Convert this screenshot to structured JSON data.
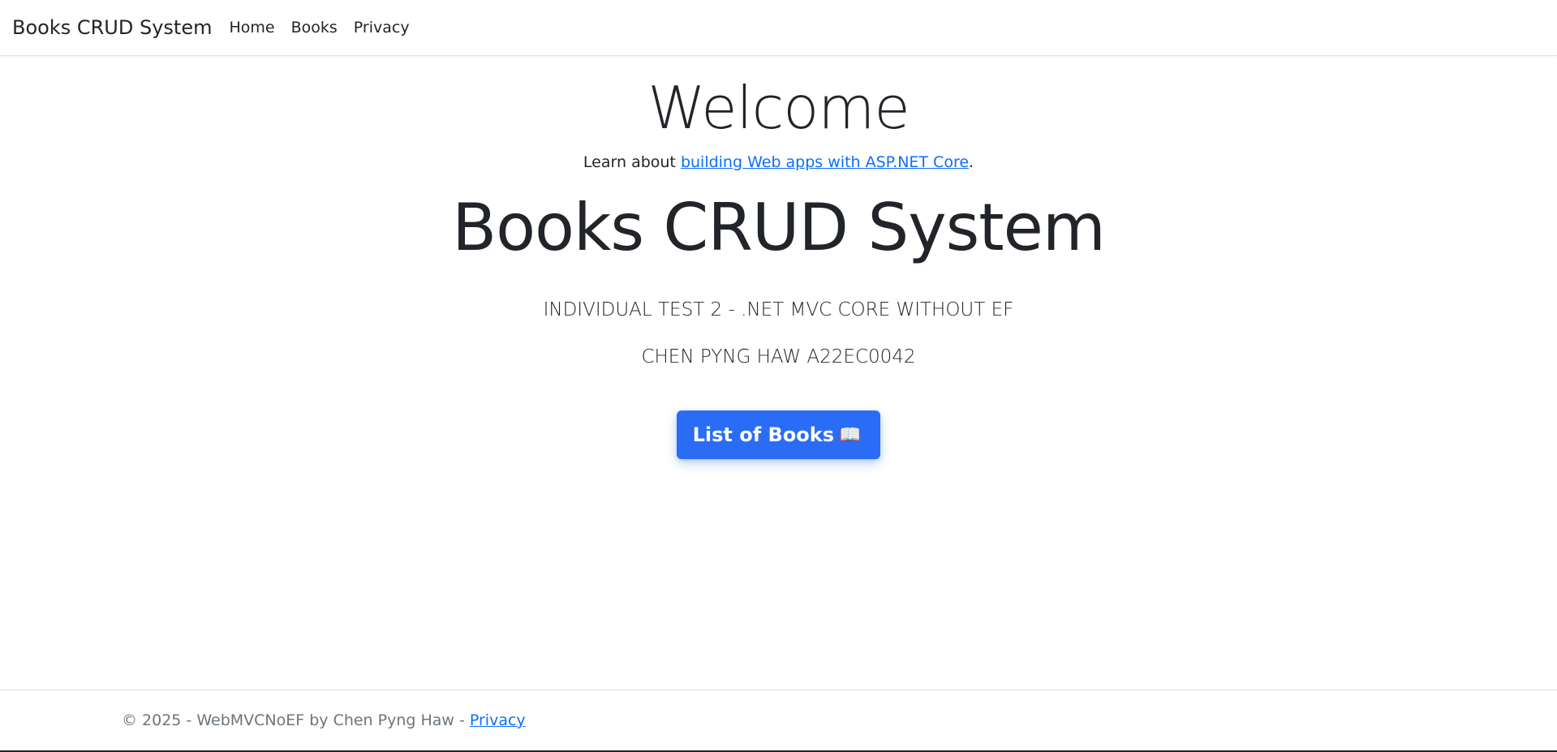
{
  "nav": {
    "brand": "Books CRUD System",
    "links": [
      {
        "label": "Home"
      },
      {
        "label": "Books"
      },
      {
        "label": "Privacy"
      }
    ]
  },
  "main": {
    "welcome": "Welcome",
    "learn_prefix": "Learn about ",
    "learn_link": "building Web apps with ASP.NET Core",
    "learn_suffix": ".",
    "title": "Books CRUD System",
    "subtitle": "INDIVIDUAL TEST 2 - .NET MVC CORE WITHOUT EF",
    "student": "CHEN PYNG HAW A22EC0042",
    "button_label": "List of Books",
    "button_icon": "📖"
  },
  "footer": {
    "text": "© 2025 - WebMVCNoEF by Chen Pyng Haw -",
    "privacy_link": "Privacy"
  },
  "colors": {
    "primary": "#2a6cf6",
    "link": "#0d6efd",
    "text": "#212529",
    "muted": "#6c757d"
  }
}
